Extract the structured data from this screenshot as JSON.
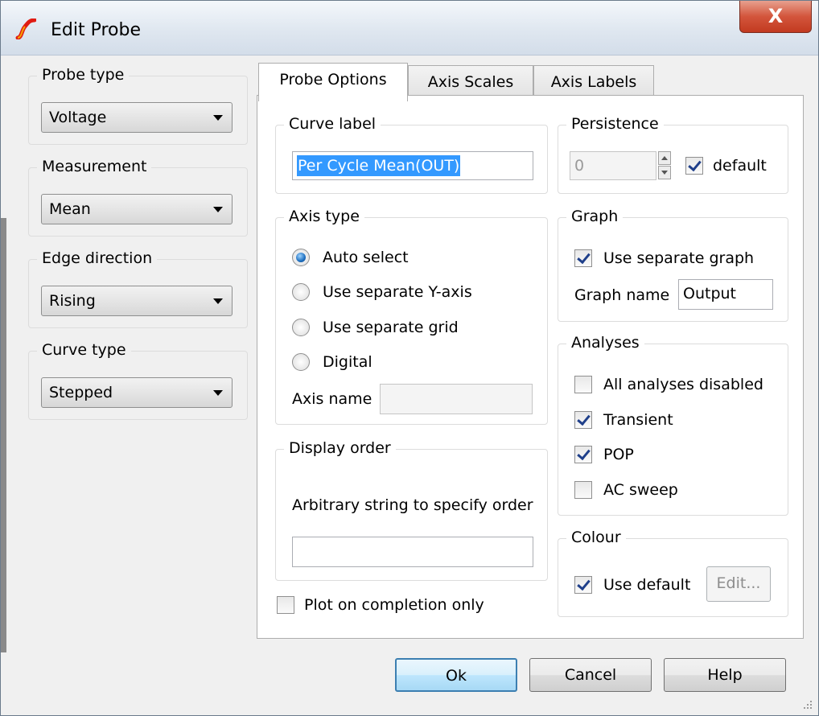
{
  "window": {
    "title": "Edit Probe",
    "close_glyph": "X"
  },
  "left": {
    "probe_type": {
      "label": "Probe type",
      "value": "Voltage"
    },
    "measurement": {
      "label": "Measurement",
      "value": "Mean"
    },
    "edge_direction": {
      "label": "Edge direction",
      "value": "Rising"
    },
    "curve_type": {
      "label": "Curve type",
      "value": "Stepped"
    }
  },
  "tabs": [
    "Probe Options",
    "Axis Scales",
    "Axis Labels"
  ],
  "curve_label": {
    "label": "Curve label",
    "value": "Per Cycle Mean(OUT)"
  },
  "persistence": {
    "label": "Persistence",
    "value": "0",
    "default_label": "default",
    "default_checked": true
  },
  "axis_type": {
    "label": "Axis type",
    "options": [
      "Auto select",
      "Use separate Y-axis",
      "Use separate grid",
      "Digital"
    ],
    "selected": 0,
    "axis_name_label": "Axis name",
    "axis_name_value": ""
  },
  "graph": {
    "label": "Graph",
    "use_separate_label": "Use separate graph",
    "use_separate_checked": true,
    "graph_name_label": "Graph name",
    "graph_name_value": "Output"
  },
  "analyses": {
    "label": "Analyses",
    "items": [
      {
        "label": "All analyses disabled",
        "checked": false
      },
      {
        "label": "Transient",
        "checked": true
      },
      {
        "label": "POP",
        "checked": true
      },
      {
        "label": "AC sweep",
        "checked": false
      }
    ]
  },
  "display_order": {
    "label": "Display order",
    "hint": "Arbitrary string to specify order",
    "value": ""
  },
  "colour": {
    "label": "Colour",
    "use_default_label": "Use default",
    "use_default_checked": true,
    "edit_label": "Edit..."
  },
  "plot_completion": {
    "label": "Plot on completion only",
    "checked": false
  },
  "buttons": {
    "ok": "Ok",
    "cancel": "Cancel",
    "help": "Help"
  },
  "colors": {
    "close": "#c23a20",
    "selection": "#3399ff",
    "default_button": "#3c7fb1"
  }
}
